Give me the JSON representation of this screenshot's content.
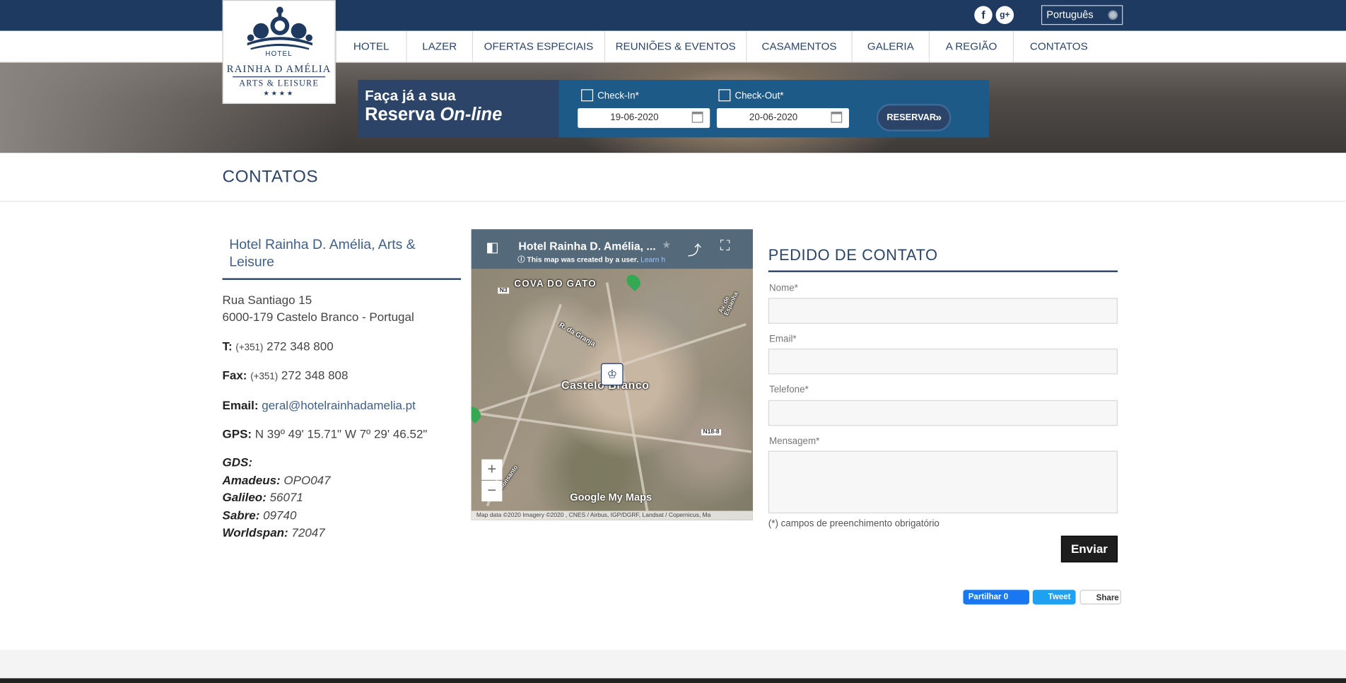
{
  "header": {
    "language": "Português",
    "social": {
      "facebook": "f",
      "google": "g+"
    }
  },
  "logo": {
    "line1": "HOTEL",
    "line2": "RAINHA D AMÉLIA",
    "line3": "ARTS & LEISURE",
    "stars": "★★★★"
  },
  "nav": [
    "HOTEL",
    "LAZER",
    "OFERTAS ESPECIAIS",
    "REUNIÕES & EVENTOS",
    "CASAMENTOS",
    "GALERIA",
    "A REGIÃO",
    "CONTATOS"
  ],
  "booking": {
    "line1": "Faça já a sua",
    "line2_a": "Reserva",
    "line2_b": "On-line",
    "checkin_label": "Check-In*",
    "checkin_value": "19-06-2020",
    "checkout_label": "Check-Out*",
    "checkout_value": "20-06-2020",
    "button": "RESERVAR",
    "button_arrow": "»"
  },
  "page_title": "CONTATOS",
  "contact": {
    "hotel_name": "Hotel Rainha D. Amélia, Arts & Leisure",
    "address1": "Rua Santiago 15",
    "address2": "6000-179 Castelo Branco - Portugal",
    "phone_label": "T:",
    "phone_prefix": "(+351)",
    "phone": "272 348 800",
    "fax_label": "Fax:",
    "fax_prefix": "(+351)",
    "fax": "272 348 808",
    "email_label": "Email:",
    "email": "geral@hotelrainhadamelia.pt",
    "gps_label": "GPS:",
    "gps": "N 39º 49' 15.71\"  W 7º 29' 46.52\""
  },
  "gds": {
    "title": "GDS:",
    "amadeus_label": "Amadeus:",
    "amadeus": "OPO047",
    "galileo_label": "Galileo:",
    "galileo": "56071",
    "sabre_label": "Sabre:",
    "sabre": "09740",
    "worldspan_label": "Worldspan:",
    "worldspan": "72047"
  },
  "map": {
    "title": "Hotel Rainha D. Amélia, ...",
    "subtitle": "This map was created by a user.",
    "learn": "Learn h",
    "place_main": "Castelo Branco",
    "place_top": "COVA DO GATO",
    "road1": "R. da Granja",
    "road2": "N3",
    "road3": "N18-8",
    "road4": "Av. de Espanha",
    "road5": "R. Monsanto",
    "zoom_in": "+",
    "zoom_out": "−",
    "brand": "Google My Maps",
    "attribution": "Map data ©2020 Imagery ©2020 , CNES / Airbus, IGP/DGRF, Landsat / Copernicus, Ma"
  },
  "form": {
    "title": "PEDIDO DE CONTATO",
    "name_label": "Nome*",
    "email_label": "Email*",
    "phone_label": "Telefone*",
    "message_label": "Mensagem*",
    "required_note": "(*) campos de preenchimento obrigatório",
    "submit": "Enviar"
  },
  "share": {
    "facebook": "Partilhar 0",
    "twitter": "Tweet",
    "linkedin": "Share"
  },
  "colors": {
    "navy": "#1f3a60",
    "link": "#3e5f87",
    "booking_blue": "#1e5a88"
  }
}
